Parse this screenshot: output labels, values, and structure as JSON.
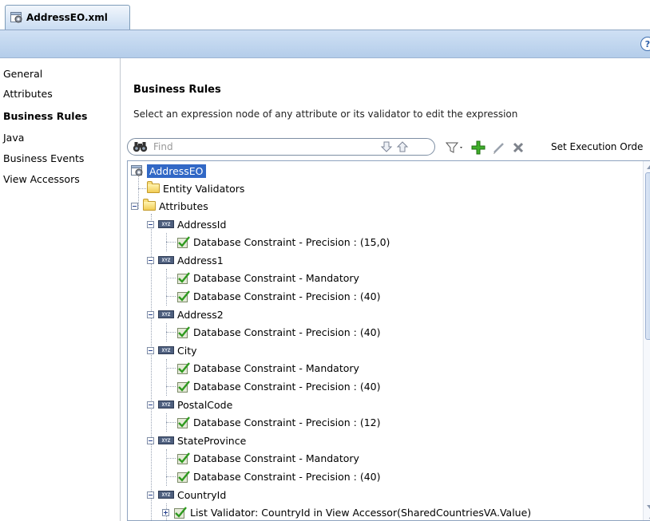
{
  "editor_tab": {
    "title": "AddressEO.xml",
    "icon": "entity-gear-icon"
  },
  "banner": {
    "help_glyph": "?"
  },
  "nav": {
    "items": [
      {
        "label": "General"
      },
      {
        "label": "Attributes"
      },
      {
        "label": "Business Rules",
        "selected": true
      },
      {
        "label": "Java"
      },
      {
        "label": "Business Events"
      },
      {
        "label": "View Accessors"
      }
    ]
  },
  "main": {
    "title": "Business Rules",
    "description": "Select an expression node of any attribute or its validator to edit the expression"
  },
  "toolbar": {
    "find_placeholder": "Find",
    "set_execution_order_label": "Set Execution Orde"
  },
  "tree": {
    "root": "AddressEO",
    "entity_validators": "Entity Validators",
    "attributes_folder": "Attributes",
    "attributes": [
      {
        "name": "AddressId",
        "rules": [
          "Database Constraint - Precision : (15,0)"
        ]
      },
      {
        "name": "Address1",
        "rules": [
          "Database Constraint - Mandatory",
          "Database Constraint - Precision : (40)"
        ]
      },
      {
        "name": "Address2",
        "rules": [
          "Database Constraint - Precision : (40)"
        ]
      },
      {
        "name": "City",
        "rules": [
          "Database Constraint - Mandatory",
          "Database Constraint - Precision : (40)"
        ]
      },
      {
        "name": "PostalCode",
        "rules": [
          "Database Constraint - Precision : (12)"
        ]
      },
      {
        "name": "StateProvince",
        "rules": [
          "Database Constraint - Mandatory",
          "Database Constraint - Precision : (40)"
        ]
      },
      {
        "name": "CountryId",
        "rules": [
          "List Validator: CountryId in View Accessor(SharedCountriesVA.Value)"
        ]
      }
    ],
    "attr_icon_text": "XYZ"
  }
}
